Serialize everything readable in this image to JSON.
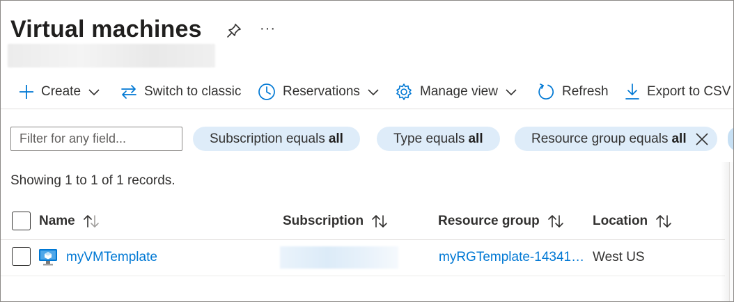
{
  "header": {
    "title": "Virtual machines",
    "more_label": "···"
  },
  "toolbar": {
    "create": "Create",
    "switch_classic": "Switch to classic",
    "reservations": "Reservations",
    "manage_view": "Manage view",
    "refresh": "Refresh",
    "export_csv": "Export to CSV"
  },
  "filter": {
    "placeholder": "Filter for any field...",
    "value": ""
  },
  "pills": [
    {
      "label": "Subscription equals",
      "value": "all"
    },
    {
      "label": "Type equals",
      "value": "all"
    },
    {
      "label": "Resource group equals",
      "value": "all"
    }
  ],
  "records_text": "Showing 1 to 1 of 1 records.",
  "table": {
    "columns": [
      "Name",
      "Subscription",
      "Resource group",
      "Location"
    ],
    "rows": [
      {
        "name": "myVMTemplate",
        "subscription": "",
        "resource_group": "myRGTemplate-14341…",
        "location": "West US"
      }
    ]
  },
  "colors": {
    "accent": "#0078d4",
    "pill_bg": "#deecf9",
    "text": "#323130"
  },
  "icons": {
    "pin": "pin-icon",
    "create": "plus-icon",
    "switch": "swap-arrows-icon",
    "reservations": "clock-icon",
    "manage_view": "gear-icon",
    "refresh": "refresh-icon",
    "export": "download-icon",
    "vm": "virtual-machine-icon"
  }
}
